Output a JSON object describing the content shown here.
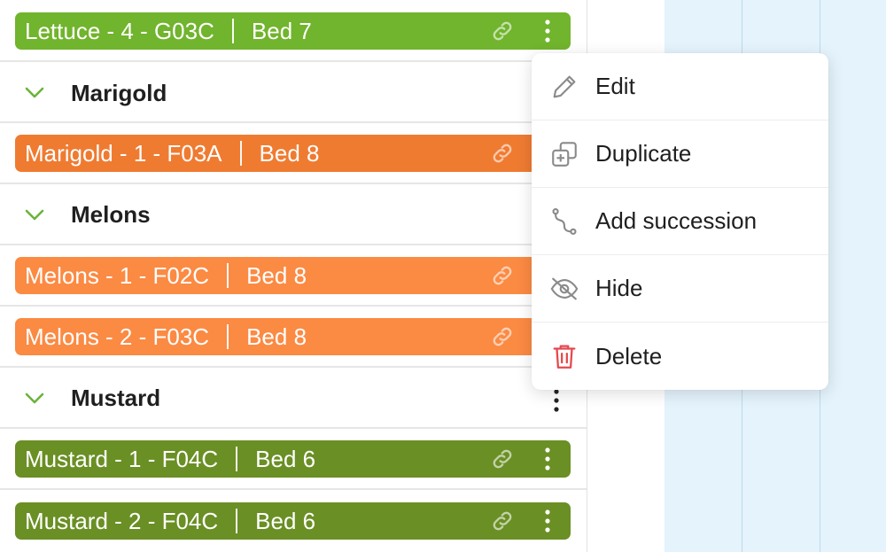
{
  "rows": [
    {
      "kind": "crop",
      "name": "Lettuce - 4 - G03C",
      "bed": "Bed 7",
      "color": "#71b42d"
    },
    {
      "kind": "group",
      "title": "Marigold"
    },
    {
      "kind": "crop",
      "name": "Marigold - 1 - F03A",
      "bed": "Bed 8",
      "color": "#ef7b31"
    },
    {
      "kind": "group",
      "title": "Melons"
    },
    {
      "kind": "crop",
      "name": "Melons - 1 - F02C",
      "bed": "Bed 8",
      "color": "#fb8a43"
    },
    {
      "kind": "crop",
      "name": "Melons - 2 - F03C",
      "bed": "Bed 8",
      "color": "#fb8a43"
    },
    {
      "kind": "group",
      "title": "Mustard"
    },
    {
      "kind": "crop",
      "name": "Mustard - 1 - F04C",
      "bed": "Bed 6",
      "color": "#6a8f24"
    },
    {
      "kind": "crop",
      "name": "Mustard - 2 - F04C",
      "bed": "Bed 6",
      "color": "#6a8f24"
    }
  ],
  "menu": {
    "items": [
      {
        "label": "Edit",
        "icon": "pencil-icon"
      },
      {
        "label": "Duplicate",
        "icon": "duplicate-icon"
      },
      {
        "label": "Add succession",
        "icon": "succession-icon"
      },
      {
        "label": "Hide",
        "icon": "eye-slash-icon"
      },
      {
        "label": "Delete",
        "icon": "trash-icon",
        "color": "#e5484d"
      }
    ]
  },
  "colors": {
    "chevron": "#6bb33a",
    "calendar_bg": "#e4f3fc"
  }
}
